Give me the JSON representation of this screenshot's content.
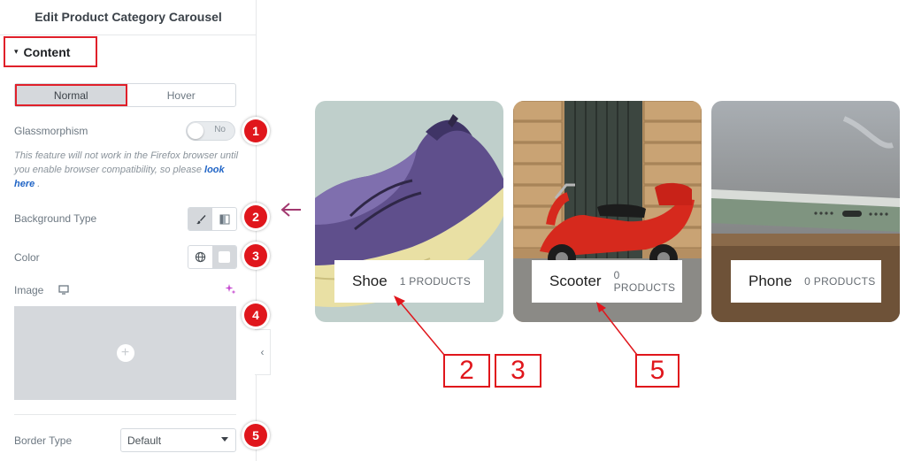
{
  "panel": {
    "title": "Edit Product Category Carousel",
    "section": {
      "label": "Content",
      "caret": "▾"
    },
    "tabs": [
      {
        "label": "Normal",
        "active": true
      },
      {
        "label": "Hover",
        "active": false
      }
    ],
    "glassmorphism": {
      "label": "Glassmorphism",
      "toggle_text": "No",
      "enabled": false
    },
    "note": {
      "text": "This feature will not work in the Firefox browser until you enable browser compatibility, so please",
      "link": "look here",
      "suffix": " ."
    },
    "background_type": {
      "label": "Background Type",
      "options": [
        "brush-icon",
        "gradient-icon"
      ],
      "selected": "brush-icon"
    },
    "color": {
      "label": "Color",
      "swatch": "#ffffff"
    },
    "image": {
      "label": "Image",
      "placeholder": "+"
    },
    "border_type": {
      "label": "Border Type",
      "value": "Default"
    },
    "collapse_glyph": "‹"
  },
  "markers": [
    "1",
    "2",
    "3",
    "4",
    "5"
  ],
  "categories": [
    {
      "name": "Shoe",
      "count": "1 PRODUCTS"
    },
    {
      "name": "Scooter",
      "count": "0 PRODUCTS"
    },
    {
      "name": "Phone",
      "count": "0 PRODUCTS"
    }
  ],
  "callouts": [
    "2",
    "3",
    "5"
  ],
  "colors": {
    "accent_red": "#e0161c",
    "arrow_purple": "#a2386f",
    "link_blue": "#2165c6"
  }
}
